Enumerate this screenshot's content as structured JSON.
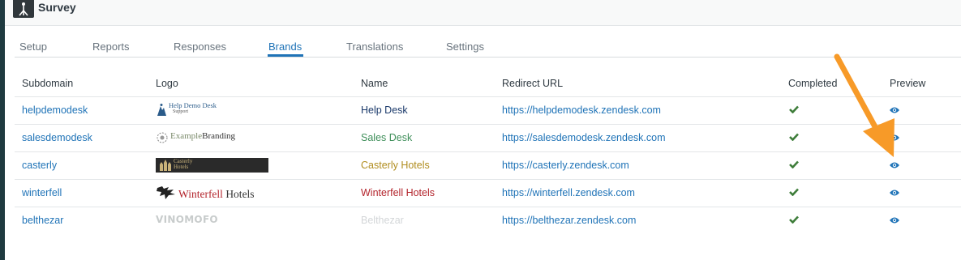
{
  "app": {
    "title": "Survey",
    "icon": "survey-app-icon"
  },
  "tabs": [
    {
      "label": "Setup",
      "active": false
    },
    {
      "label": "Reports",
      "active": false
    },
    {
      "label": "Responses",
      "active": false
    },
    {
      "label": "Brands",
      "active": true
    },
    {
      "label": "Translations",
      "active": false
    },
    {
      "label": "Settings",
      "active": false
    }
  ],
  "table": {
    "headers": {
      "subdomain": "Subdomain",
      "logo": "Logo",
      "name": "Name",
      "redirect_url": "Redirect URL",
      "completed": "Completed",
      "preview": "Preview"
    },
    "rows": [
      {
        "subdomain": "helpdemodesk",
        "logo_text": "Help Demo Desk",
        "logo_subtext": "Support",
        "name": "Help Desk",
        "name_color": "#1b3a6b",
        "redirect_url": "https://helpdemodesk.zendesk.com",
        "completed": true
      },
      {
        "subdomain": "salesdemodesk",
        "logo_text": "Example",
        "logo_text2": "Branding",
        "name": "Sales Desk",
        "name_color": "#3f8f5a",
        "redirect_url": "https://salesdemodesk.zendesk.com",
        "completed": true
      },
      {
        "subdomain": "casterly",
        "logo_text": "Casterly",
        "logo_text2": "Hotels",
        "name": "Casterly Hotels",
        "name_color": "#b08d1f",
        "redirect_url": "https://casterly.zendesk.com",
        "completed": true
      },
      {
        "subdomain": "winterfell",
        "logo_text": "Winterfell",
        "logo_text2": "Hotels",
        "name": "Winterfell Hotels",
        "name_color": "#b3242c",
        "redirect_url": "https://winterfell.zendesk.com",
        "completed": true
      },
      {
        "subdomain": "belthezar",
        "logo_text": "VINOMOFO",
        "name": "Belthezar",
        "name_color": "#d3d6d8",
        "redirect_url": "https://belthezar.zendesk.com",
        "completed": true
      }
    ]
  },
  "colors": {
    "link": "#1f73b7",
    "check": "#3e7d3a",
    "arrow": "#f79a28",
    "sidebar": "#1f3a40"
  }
}
